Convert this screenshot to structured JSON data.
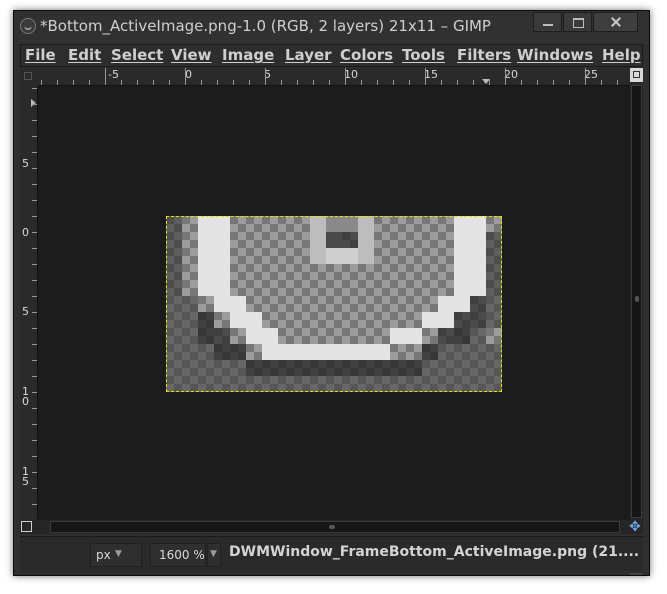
{
  "window": {
    "title": "*Bottom_ActiveImage.png-1.0 (RGB, 2 layers) 21x11 – GIMP"
  },
  "menubar": {
    "items": [
      "File",
      "Edit",
      "Select",
      "View",
      "Image",
      "Layer",
      "Colors",
      "Tools",
      "Filters",
      "Windows",
      "Help"
    ]
  },
  "rulers": {
    "horizontal_labels": [
      "-5",
      "0",
      "5",
      "10",
      "15",
      "20",
      "25"
    ],
    "vertical_labels": [
      "5",
      "0",
      "5",
      "1\n0",
      "1\n5"
    ]
  },
  "statusbar": {
    "unit": "px",
    "zoom": "1600 %",
    "message": "DWMWindow_FrameBottom_ActiveImage.png (21...."
  },
  "colors": {
    "selection": "#e8e000",
    "canvas_bg": "#1c1c1c"
  },
  "icons": {
    "app": "gimp-wilber-icon",
    "minimize": "minimize-icon",
    "maximize": "maximize-icon",
    "close": "close-icon",
    "quick_mask": "quick-mask-icon",
    "navigate": "navigate-icon",
    "zoom_to_window": "zoom-toggle-icon"
  }
}
